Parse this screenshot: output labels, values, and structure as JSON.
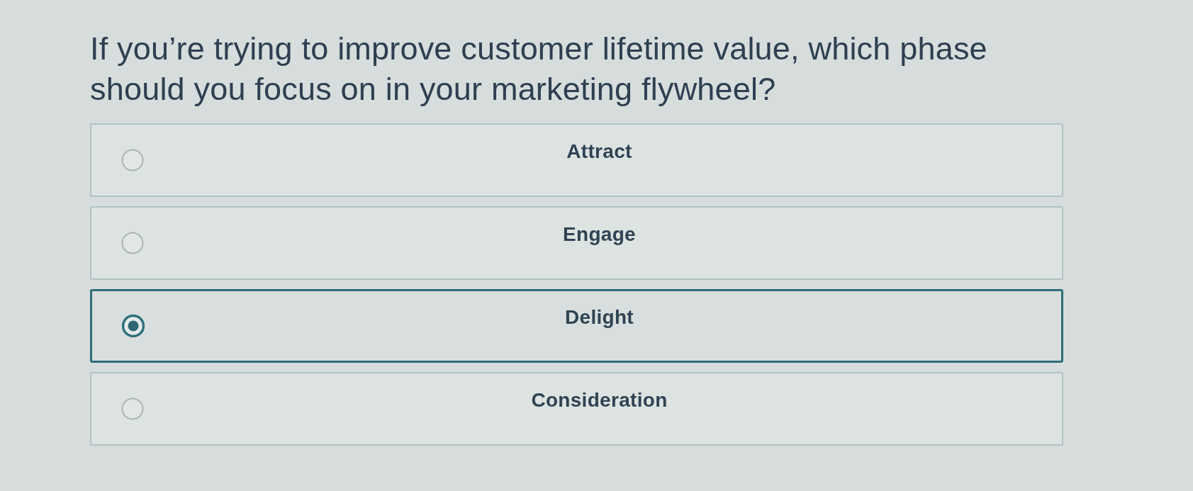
{
  "question": "If you’re trying to improve customer lifetime value, which phase should you focus on in your marketing flywheel?",
  "options": [
    {
      "label": "Attract",
      "selected": false
    },
    {
      "label": "Engage",
      "selected": false
    },
    {
      "label": "Delight",
      "selected": true
    },
    {
      "label": "Consideration",
      "selected": false
    }
  ]
}
